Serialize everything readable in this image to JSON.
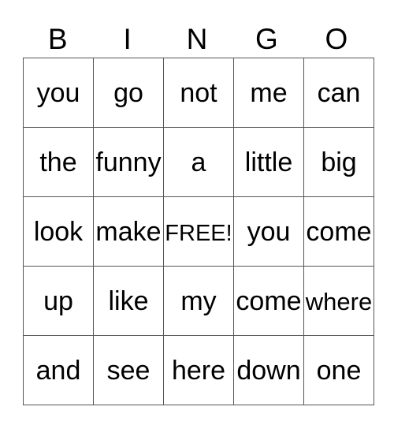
{
  "card": {
    "header": [
      "B",
      "I",
      "N",
      "G",
      "O"
    ],
    "rows": [
      [
        "you",
        "go",
        "not",
        "me",
        "can"
      ],
      [
        "the",
        "funny",
        "a",
        "little",
        "big"
      ],
      [
        "look",
        "make",
        "FREE!",
        "you",
        "come"
      ],
      [
        "up",
        "like",
        "my",
        "come",
        "where"
      ],
      [
        "and",
        "see",
        "here",
        "down",
        "one"
      ]
    ]
  }
}
